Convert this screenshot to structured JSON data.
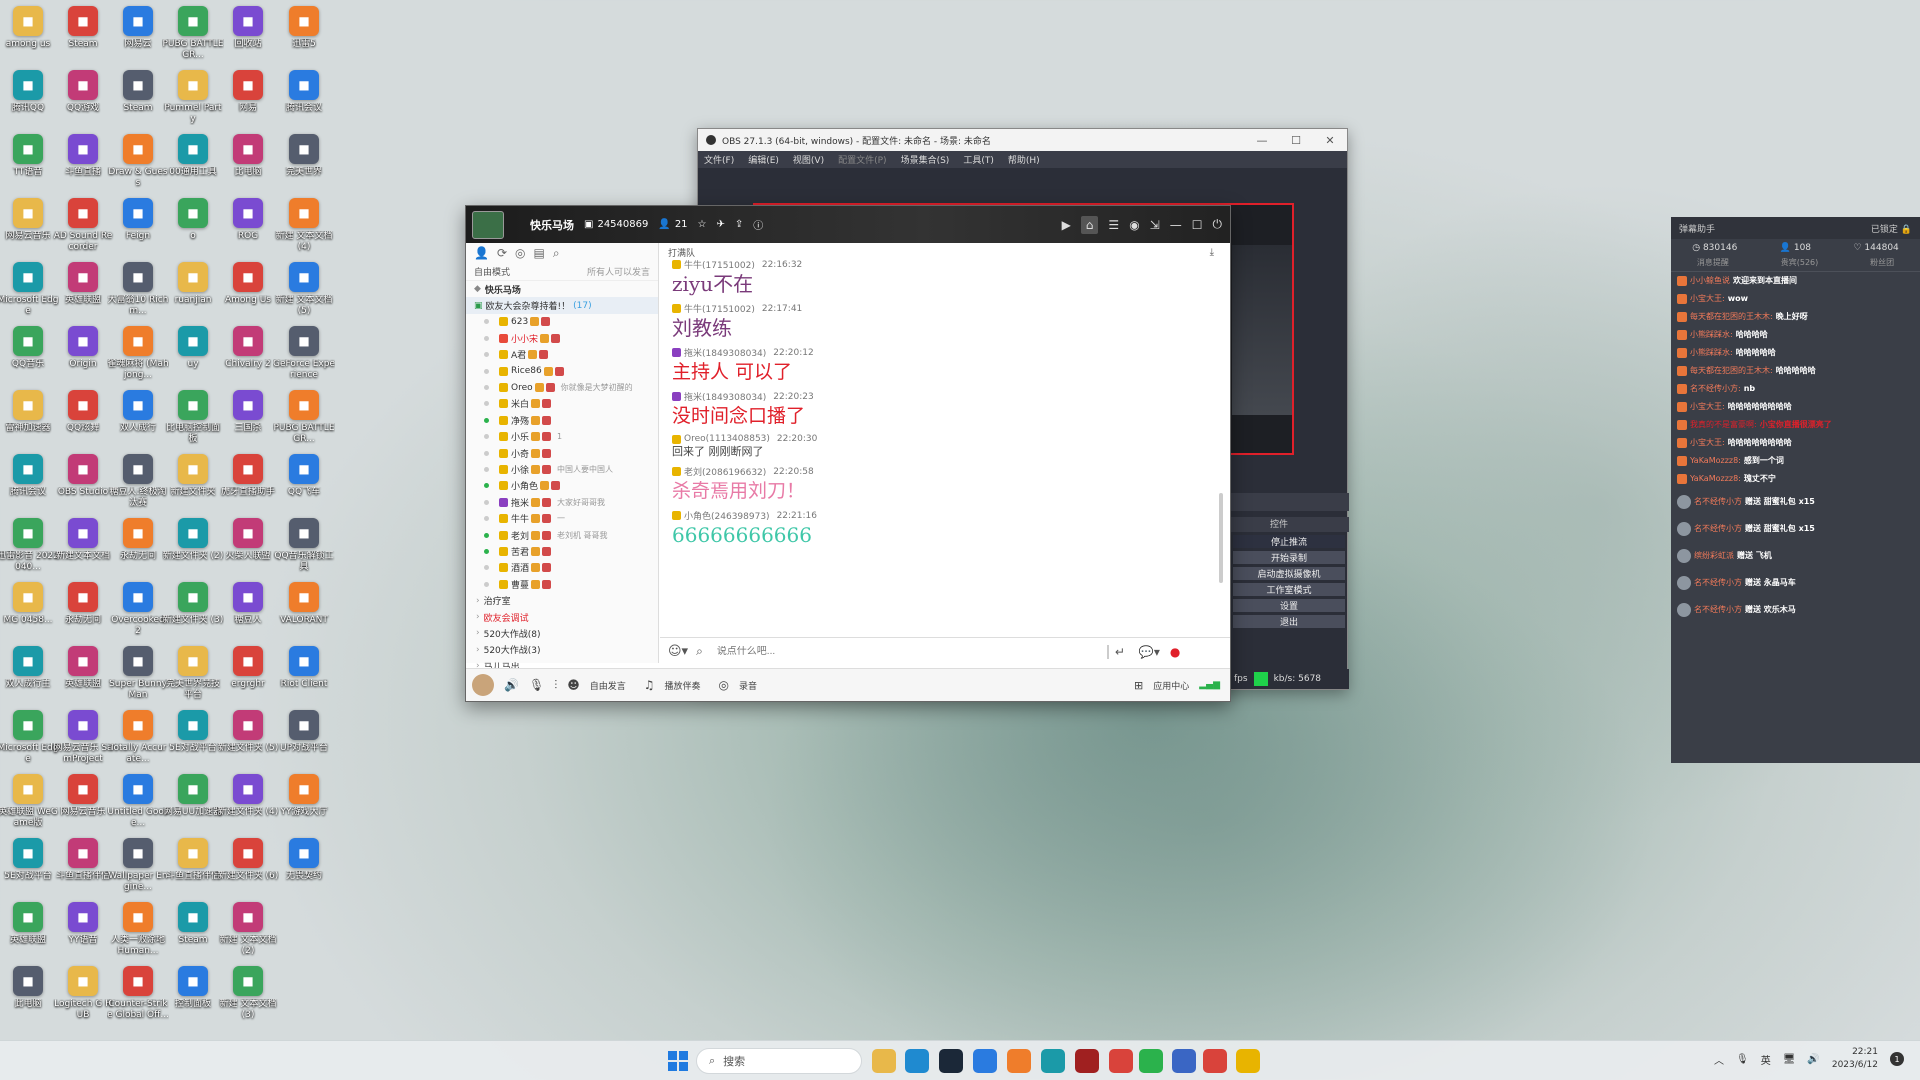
{
  "desktop_icons": [
    [
      "among us",
      "Steam"
    ],
    [
      "网易云",
      "PUBG BATTLEGR..."
    ],
    [
      "回收站",
      "迅雷5"
    ],
    [
      "腾讯QQ",
      "QQ游戏"
    ],
    [
      "Steam",
      "Pummel Party"
    ],
    [
      "网易",
      "腾讯会议"
    ],
    [
      "TT语音",
      "斗鱼直播"
    ],
    [
      "Draw & Guess",
      "00通用工具"
    ],
    [
      "比电脑",
      "完美世界"
    ],
    [
      "网易云音乐",
      "AD Sound Recorder"
    ],
    [
      "Feign",
      "o"
    ],
    [
      "ROG",
      "新建 文本文档 (4)"
    ],
    [
      "Microsoft Edge",
      "英雄联盟"
    ],
    [
      "大富翁10 Richm...",
      "ruanjian"
    ],
    [
      "Among Us",
      "新建 文本文档 (5)"
    ],
    [
      "QQ音乐",
      "Origin"
    ],
    [
      "雀魂麻将 (Mahjong...",
      "uy"
    ],
    [
      "Chivalry 2",
      "GeForce Experience"
    ],
    [
      "雷神加速器",
      "QQ炫舞"
    ],
    [
      "双人成行",
      "比电脑控制面板"
    ],
    [
      "三国杀",
      "PUBG BATTLEGR..."
    ],
    [
      "腾讯会议",
      "OBS Studio"
    ],
    [
      "糖豆人:终极淘汰赛",
      "新建文件夹"
    ],
    [
      "虎牙直播助手",
      "QQ飞车"
    ],
    [
      "迅雷影音 2022040...",
      "新建文本文档"
    ],
    [
      "永劫无间",
      "新建文件夹 (2)"
    ],
    [
      "火柴人联盟",
      "QQ音乐解锁工具"
    ],
    [
      "MG 0458...",
      "永劫无间"
    ],
    [
      "Overcooked 2",
      "新建文件夹 (3)"
    ],
    [
      "糖豆人",
      "VALORANT"
    ],
    [
      "双人成行主",
      "英雄联盟"
    ],
    [
      "Super Bunny Man",
      "完美世界竞技平台"
    ],
    [
      "ergrghr",
      "Riot Client"
    ],
    [
      "Microsoft Edge",
      "网易云音乐 SamProject"
    ],
    [
      "Totally Accurate...",
      "5E对战平台"
    ],
    [
      "新建文件夹 (5)",
      "UP对战平台"
    ],
    [
      "英雄联盟 WeGame版",
      "网易云音乐"
    ],
    [
      "Untitled Goose...",
      "网易UU加速器"
    ],
    [
      "新建文件夹 (4)",
      "YY游戏大厅"
    ],
    [
      "5E对战平台",
      "斗鱼直播伴侣"
    ],
    [
      "Wallpaper Engine...",
      "斗鱼直播伴侣"
    ],
    [
      "新建文件夹 (6)",
      "无畏契约"
    ],
    [
      "英雄联盟",
      "YY语音"
    ],
    [
      "人类一败涂地 Human...",
      "Steam"
    ],
    [
      "新建 文本文档 (2)",
      ""
    ],
    [
      "此电脑",
      "Logitech G HUB"
    ],
    [
      "Counter-Strike Global Off...",
      "控制面板"
    ],
    [
      "新建 文本文档 (3)",
      ""
    ]
  ],
  "taskbar": {
    "search_placeholder": "搜索",
    "time": "22:21",
    "date": "2023/6/12",
    "ime": "英"
  },
  "obs": {
    "title": "OBS 27.1.3 (64-bit, windows) - 配置文件: 未命名 - 场景: 未命名",
    "menu": [
      "文件(F)",
      "编辑(E)",
      "视图(V)",
      "配置文件(P)",
      "场景集合(S)",
      "工具(T)",
      "帮助(H)"
    ],
    "controls_header": "控件",
    "controls": [
      "停止推流",
      "开始录制",
      "启动虚拟摄像机",
      "工作室模式",
      "设置",
      "退出"
    ],
    "status_fps": "fps",
    "status_kbps": "kb/s: 5678"
  },
  "yy": {
    "channel_name": "快乐马场",
    "channel_id": "24540869",
    "online": "21",
    "mode_left": "自由模式",
    "mode_right": "所有人可以发言",
    "tree_root": "快乐马场",
    "tree_group": "欧友大会杂尊持着!！",
    "tree_group_count": "(17)",
    "members": [
      "623",
      "小小宋",
      "A君",
      "Rice86",
      "Oreo",
      "米白",
      "净殇",
      "小乐",
      "小奇",
      "小徐",
      "小角色",
      "拖米",
      "牛牛",
      "老刘",
      "苦君",
      "酒酒",
      "曹蔓"
    ],
    "member_notes": [
      "",
      "",
      "",
      "",
      "你就像是大梦初醒的",
      "",
      "",
      "1",
      "",
      "中国人要中国人",
      "",
      "大家好哥哥我",
      "一",
      "老刘机 哥哥我",
      "",
      "",
      ""
    ],
    "subchannels": [
      "治疗室",
      "欧友会调试",
      "520大作战(8)",
      "520大作战(3)",
      "马儿马出"
    ],
    "chat_tab": "打满队",
    "messages": [
      {
        "user": "牛牛(17151002)",
        "time": "22:16:32",
        "text": "ziyu不在",
        "color": "#7a3a7a",
        "size": "20px",
        "crown": "#e8b400"
      },
      {
        "user": "牛牛(17151002)",
        "time": "22:17:41",
        "text": "刘教练",
        "color": "#7a3a7a",
        "size": "20px",
        "crown": "#e8b400"
      },
      {
        "user": "拖米(1849308034)",
        "time": "22:20:12",
        "text": "主持人 可以了",
        "color": "#e0202a",
        "size": "19px",
        "crown": "#8a3fc0"
      },
      {
        "user": "拖米(1849308034)",
        "time": "22:20:23",
        "text": "没时间念口播了",
        "color": "#e0202a",
        "size": "19px",
        "crown": "#8a3fc0"
      },
      {
        "user": "Oreo(1113408853)",
        "time": "22:20:30",
        "text": "回来了 刚刚断网了",
        "color": "#444",
        "size": "11px",
        "crown": "#e8b400"
      },
      {
        "user": "老刘(2086196632)",
        "time": "22:20:58",
        "text": "杀奇焉用刘刀！",
        "color": "#e87aa6",
        "size": "19px",
        "crown": "#e8b400"
      },
      {
        "user": "小角色(246398973)",
        "time": "22:21:16",
        "text": "66666666666",
        "color": "#3fc7a8",
        "size": "20px",
        "crown": "#e8b400"
      }
    ],
    "input_placeholder": "说点什么吧...",
    "bottom": {
      "free_speak": "自由发言",
      "music": "播放伴奏",
      "record": "录音",
      "app_center": "应用中心"
    }
  },
  "danmaku": {
    "title": "弹幕助手",
    "locked": "已锁定",
    "stats": [
      "830146",
      "108",
      "144804"
    ],
    "tabs": [
      "消息提醒",
      "贵宾(526)",
      "粉丝团"
    ],
    "rows": [
      {
        "name": "小小鲸鱼说",
        "text": "欢迎来到本直播间",
        "nc": "#f27a5a"
      },
      {
        "name": "小宝大王:",
        "text": "wow",
        "nc": "#f27a5a"
      },
      {
        "name": "每天都在犯困的王木木:",
        "text": "晚上好呀",
        "nc": "#f27a5a"
      },
      {
        "name": "小熊踩踩水:",
        "text": "哈哈哈哈",
        "nc": "#f27a5a"
      },
      {
        "name": "小熊踩踩水:",
        "text": "哈哈哈哈哈",
        "nc": "#f27a5a"
      },
      {
        "name": "每天都在犯困的王木木:",
        "text": "哈哈哈哈哈",
        "nc": "#f27a5a"
      },
      {
        "name": "名不经传小方:",
        "text": "nb",
        "nc": "#f27a5a"
      },
      {
        "name": "小宝大王:",
        "text": "哈哈哈哈哈哈哈哈",
        "nc": "#f27a5a"
      },
      {
        "name": "我真的不是富豪啊:",
        "text": "小宝你直播很漂亮了",
        "nc": "#e0202a"
      },
      {
        "name": "小宝大王:",
        "text": "哈哈哈哈哈哈哈哈",
        "nc": "#f27a5a"
      },
      {
        "name": "YaKaMozzz8:",
        "text": "感到一个词",
        "nc": "#f27a5a"
      },
      {
        "name": "YaKaMozzz8:",
        "text": "瑰丈不宁",
        "nc": "#f27a5a"
      },
      {
        "name": "名不经传小方",
        "text": "赠送 甜蜜礼包 x15",
        "nc": "#f27a5a"
      },
      {
        "name": "名不经传小方",
        "text": "赠送 甜蜜礼包 x15",
        "nc": "#f27a5a"
      },
      {
        "name": "缤纷彩虹派",
        "text": "赠送 飞机",
        "nc": "#f27a5a"
      },
      {
        "name": "名不经传小方",
        "text": "赠送 永晶马车",
        "nc": "#f27a5a"
      },
      {
        "name": "名不经传小方",
        "text": "赠送 欢乐木马",
        "nc": "#f27a5a"
      }
    ]
  }
}
